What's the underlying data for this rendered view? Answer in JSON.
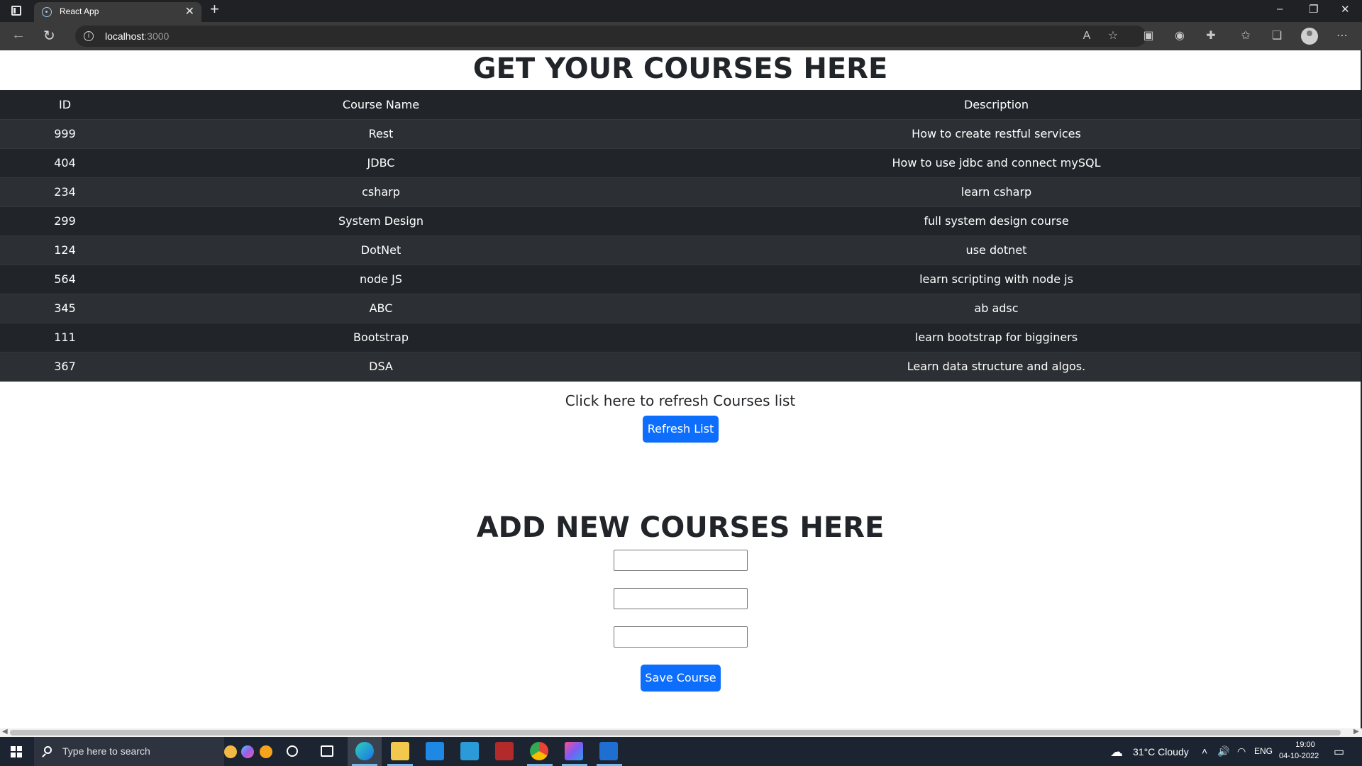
{
  "browser": {
    "tab_title": "React App",
    "tab_close": "✕",
    "new_tab": "+",
    "url_host": "localhost",
    "url_port": ":3000",
    "window_controls": [
      "–",
      "❐",
      "✕"
    ],
    "toolbar_icons": [
      "read-aloud-icon",
      "add-favorite-icon",
      "extension-icon",
      "github-icon",
      "puzzle-icon",
      "favorites-icon",
      "collections-icon",
      "profile-icon",
      "more-icon"
    ]
  },
  "page": {
    "title": "GET YOUR COURSES HERE",
    "table": {
      "headers": [
        "ID",
        "Course Name",
        "Description"
      ],
      "rows": [
        {
          "id": "999",
          "name": "Rest",
          "description": "How to create restful services"
        },
        {
          "id": "404",
          "name": "JDBC",
          "description": "How to use jdbc and connect mySQL"
        },
        {
          "id": "234",
          "name": "csharp",
          "description": "learn csharp"
        },
        {
          "id": "299",
          "name": "System Design",
          "description": "full system design course"
        },
        {
          "id": "124",
          "name": "DotNet",
          "description": "use dotnet"
        },
        {
          "id": "564",
          "name": "node JS",
          "description": "learn scripting with node js"
        },
        {
          "id": "345",
          "name": "ABC",
          "description": "ab adsc"
        },
        {
          "id": "111",
          "name": "Bootstrap",
          "description": "learn bootstrap for bigginers"
        },
        {
          "id": "367",
          "name": "DSA",
          "description": "Learn data structure and algos."
        }
      ]
    },
    "refresh_text": "Click here to refresh Courses list",
    "refresh_button": "Refresh List",
    "add_title": "ADD NEW COURSES HERE",
    "fields": [
      {
        "name": "course-id-input",
        "value": ""
      },
      {
        "name": "course-name-input",
        "value": ""
      },
      {
        "name": "course-description-input",
        "value": ""
      }
    ],
    "save_button": "Save Course"
  },
  "taskbar": {
    "search_placeholder": "Type here to search",
    "weather": "31°C  Cloudy",
    "language": "ENG",
    "time": "19:00",
    "date": "04-10-2022",
    "colors": {
      "accent": "#0d6efd",
      "table_dark": "#212529",
      "table_stripe": "#2c3034"
    }
  }
}
